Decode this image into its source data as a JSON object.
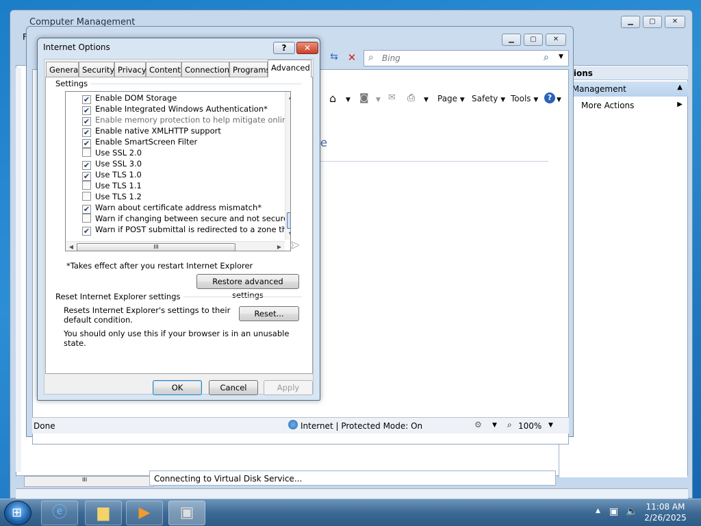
{
  "computer_management": {
    "title": "Computer Management",
    "actions_header": "ctions",
    "actions_subheader": "k Management",
    "more_actions": "More Actions",
    "status": "Connecting to Virtual Disk Service...",
    "menu_partial": "Fi"
  },
  "ie": {
    "search_placeholder": "Bing",
    "commands": {
      "page": "Page",
      "safety": "Safety",
      "tools": "Tools"
    },
    "page_text": "ge",
    "status_done": "Done",
    "status_zone": "Internet | Protected Mode: On",
    "zoom": "100%"
  },
  "dialog": {
    "title": "Internet Options",
    "help": "?",
    "close": "✕",
    "tabs": [
      "General",
      "Security",
      "Privacy",
      "Content",
      "Connections",
      "Programs",
      "Advanced"
    ],
    "active_tab": "Advanced",
    "settings_label": "Settings",
    "settings": [
      {
        "label": "Enable DOM Storage",
        "checked": true,
        "dim": false
      },
      {
        "label": "Enable Integrated Windows Authentication*",
        "checked": true,
        "dim": false
      },
      {
        "label": "Enable memory protection to help mitigate online attacks*",
        "checked": true,
        "dim": true
      },
      {
        "label": "Enable native XMLHTTP support",
        "checked": true,
        "dim": false
      },
      {
        "label": "Enable SmartScreen Filter",
        "checked": true,
        "dim": false
      },
      {
        "label": "Use SSL 2.0",
        "checked": false,
        "dim": false
      },
      {
        "label": "Use SSL 3.0",
        "checked": true,
        "dim": false
      },
      {
        "label": "Use TLS 1.0",
        "checked": true,
        "dim": false
      },
      {
        "label": "Use TLS 1.1",
        "checked": false,
        "dim": false
      },
      {
        "label": "Use TLS 1.2",
        "checked": false,
        "dim": false
      },
      {
        "label": "Warn about certificate address mismatch*",
        "checked": true,
        "dim": false
      },
      {
        "label": "Warn if changing between secure and not secure mode",
        "checked": false,
        "dim": false
      },
      {
        "label": "Warn if POST submittal is redirected to a zone that does n",
        "checked": true,
        "dim": false
      }
    ],
    "restart_note": "*Takes effect after you restart Internet Explorer",
    "restore_button": "Restore advanced settings",
    "reset_group_label": "Reset Internet Explorer settings",
    "reset_description": "Resets Internet Explorer's settings to their default condition.",
    "reset_button": "Reset...",
    "reset_warning": "You should only use this if your browser is in an unusable state.",
    "ok": "OK",
    "cancel": "Cancel",
    "apply": "Apply",
    "hscroll_grip": "III"
  },
  "taskbar": {
    "time": "11:08 AM",
    "date": "2/26/2025"
  }
}
